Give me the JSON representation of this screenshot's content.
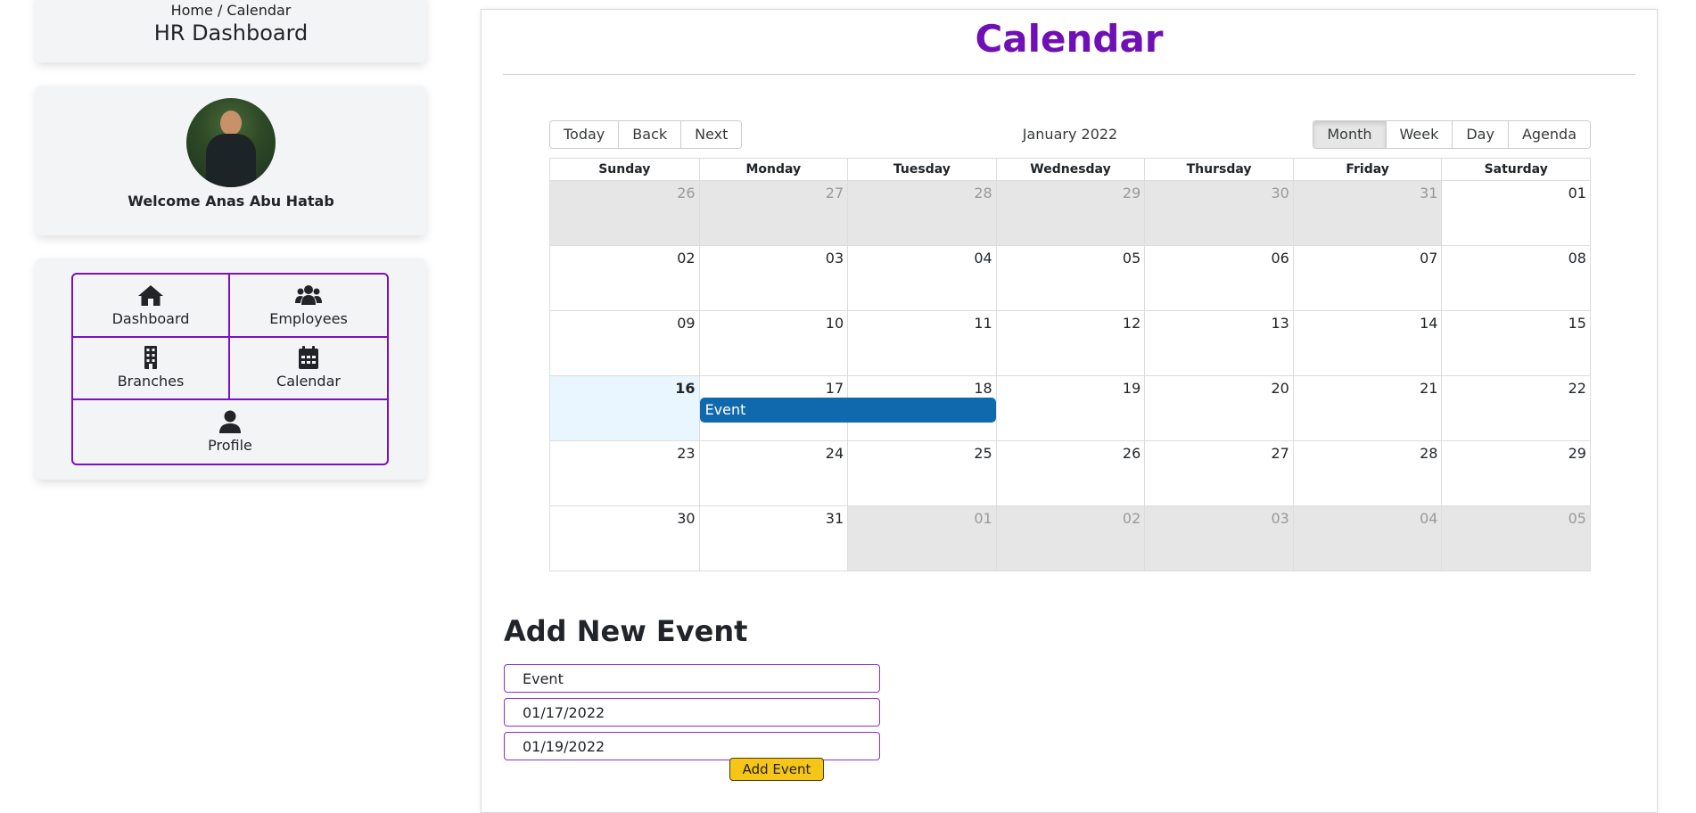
{
  "sidebar": {
    "breadcrumb": "Home / Calendar",
    "title": "HR Dashboard",
    "welcome": "Welcome Anas Abu Hatab",
    "nav": [
      {
        "label": "Dashboard",
        "icon": "home-icon"
      },
      {
        "label": "Employees",
        "icon": "users-icon"
      },
      {
        "label": "Branches",
        "icon": "building-icon"
      },
      {
        "label": "Calendar",
        "icon": "calendar-icon"
      },
      {
        "label": "Profile",
        "icon": "user-icon"
      }
    ]
  },
  "main": {
    "title": "Calendar",
    "accent_color": "#6f0fb5",
    "event_color": "#1169ad"
  },
  "toolbar": {
    "nav_buttons": [
      "Today",
      "Back",
      "Next"
    ],
    "label": "January 2022",
    "views": [
      "Month",
      "Week",
      "Day",
      "Agenda"
    ],
    "active_view": "Month"
  },
  "calendar": {
    "weekdays": [
      "Sunday",
      "Monday",
      "Tuesday",
      "Wednesday",
      "Thursday",
      "Friday",
      "Saturday"
    ],
    "weeks": [
      [
        "26",
        "27",
        "28",
        "29",
        "30",
        "31",
        "01"
      ],
      [
        "02",
        "03",
        "04",
        "05",
        "06",
        "07",
        "08"
      ],
      [
        "09",
        "10",
        "11",
        "12",
        "13",
        "14",
        "15"
      ],
      [
        "16",
        "17",
        "18",
        "19",
        "20",
        "21",
        "22"
      ],
      [
        "23",
        "24",
        "25",
        "26",
        "27",
        "28",
        "29"
      ],
      [
        "30",
        "31",
        "01",
        "02",
        "03",
        "04",
        "05"
      ]
    ],
    "today": "16",
    "events": [
      {
        "title": "Event",
        "week": 3,
        "start_day": 1,
        "span_days": 2
      }
    ]
  },
  "form": {
    "heading": "Add New Event",
    "title_value": "Event",
    "start_value": "01/17/2022",
    "end_value": "01/19/2022",
    "submit_label": "Add Event",
    "button_color": "#f5c518"
  }
}
